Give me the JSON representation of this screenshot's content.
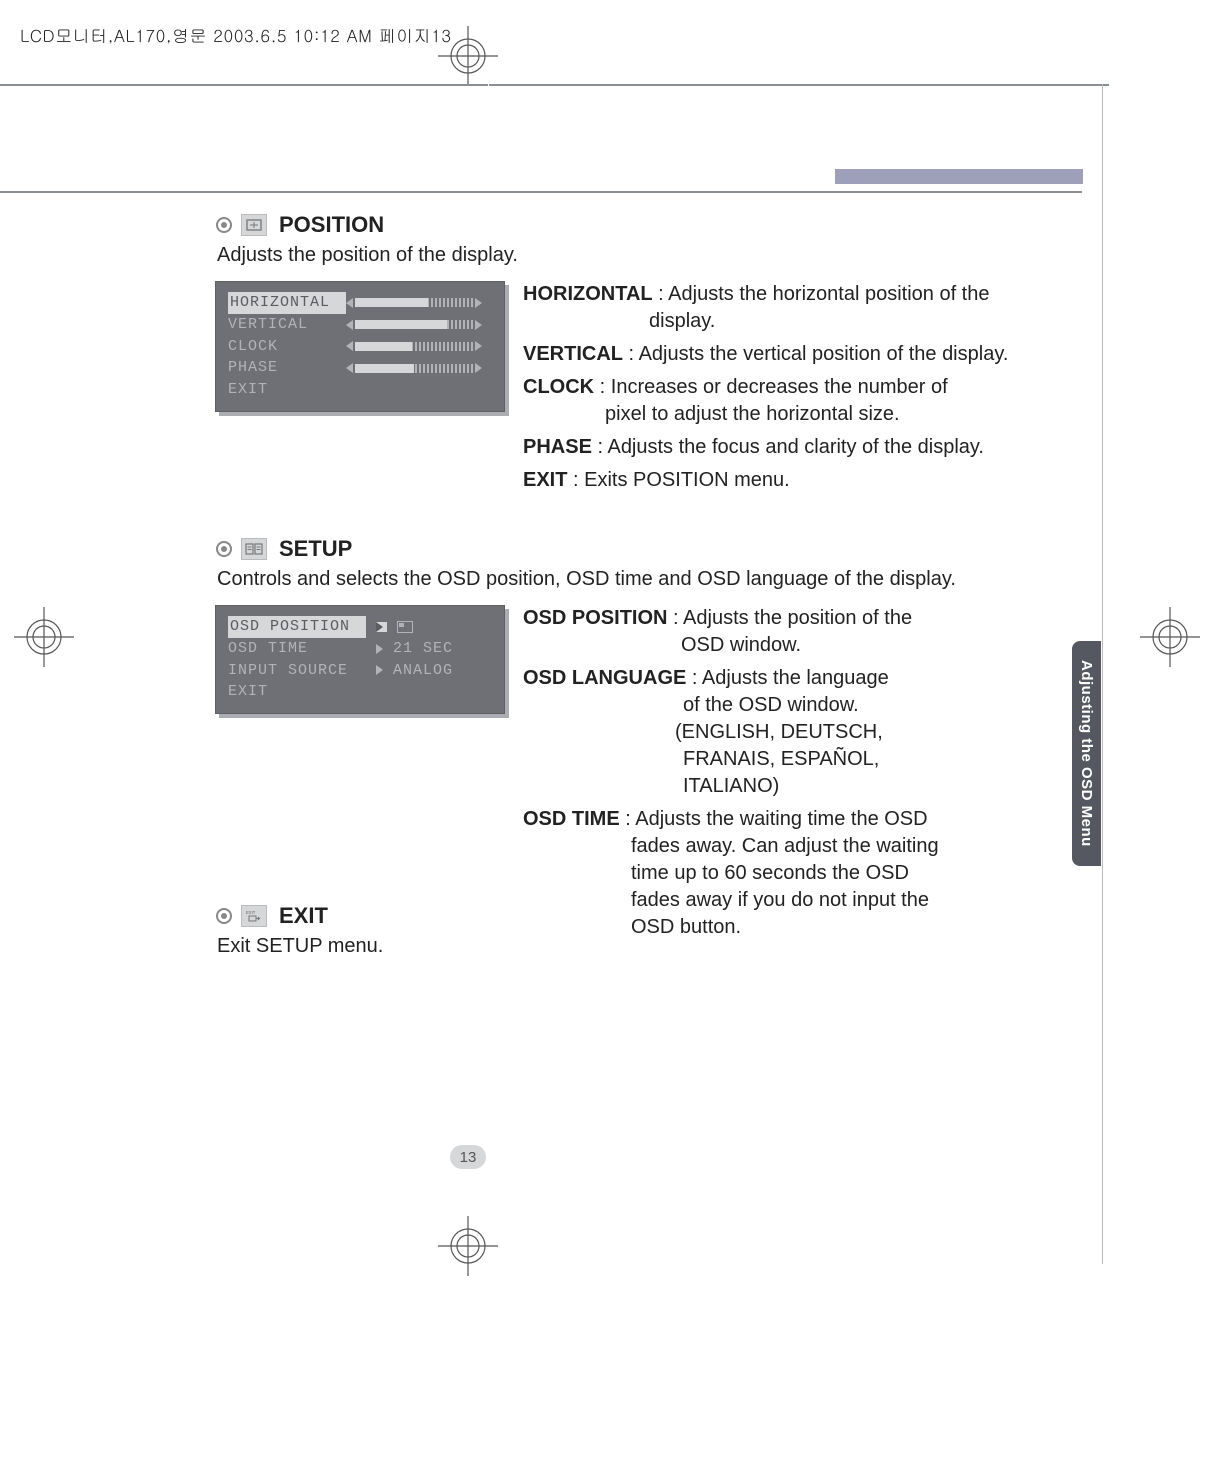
{
  "meta": {
    "filestamp": "LCD모니터,AL170,영문  2003.6.5 10:12 AM  페이지13",
    "page_number": "13",
    "side_tab": "Adjusting the OSD Menu"
  },
  "position": {
    "title": "POSITION",
    "intro": "Adjusts the position of the display.",
    "osd": {
      "horizontal": "HORIZONTAL",
      "vertical": "VERTICAL",
      "clock": "CLOCK",
      "phase": "PHASE",
      "exit": "EXIT"
    },
    "items": {
      "horizontal": {
        "term": "HORIZONTAL",
        "rest1": " : Adjusts the horizontal position of the",
        "rest2": "display."
      },
      "vertical": {
        "term": "VERTICAL",
        "rest": " : Adjusts the vertical position of the display."
      },
      "clock": {
        "term": "CLOCK",
        "rest1": " : Increases or decreases the number of",
        "rest2": "pixel to adjust the horizontal size."
      },
      "phase": {
        "term": "PHASE",
        "rest": " : Adjusts the focus and clarity of the display."
      },
      "exit": {
        "term": "EXIT",
        "rest": " : Exits POSITION menu."
      }
    }
  },
  "setup": {
    "title": "SETUP",
    "intro": "Controls and selects the OSD position, OSD time and OSD language of the display.",
    "osd": {
      "osd_position": "OSD POSITION",
      "osd_time": "OSD TIME",
      "osd_time_val": "21 SEC",
      "input_source": "INPUT SOURCE",
      "input_source_val": "ANALOG",
      "exit": "EXIT"
    },
    "items": {
      "osd_position": {
        "term": "OSD POSITION",
        "rest1": " : Adjusts the position of the",
        "rest2": "OSD window."
      },
      "osd_language": {
        "term": "OSD LANGUAGE",
        "rest1": " : Adjusts the language",
        "rest2": "of the OSD window.",
        "rest3": "(ENGLISH, DEUTSCH,",
        "rest4": "FRANAIS, ESPAÑOL,",
        "rest5": "ITALIANO)"
      },
      "osd_time": {
        "term": "OSD TIME",
        "rest1": " : Adjusts the waiting time the OSD",
        "rest2": "fades away. Can adjust the waiting",
        "rest3": "time up to 60 seconds the OSD",
        "rest4": "fades away if you do not input the",
        "rest5": "OSD button."
      }
    }
  },
  "exit": {
    "title": "EXIT",
    "intro": "Exit SETUP menu."
  }
}
